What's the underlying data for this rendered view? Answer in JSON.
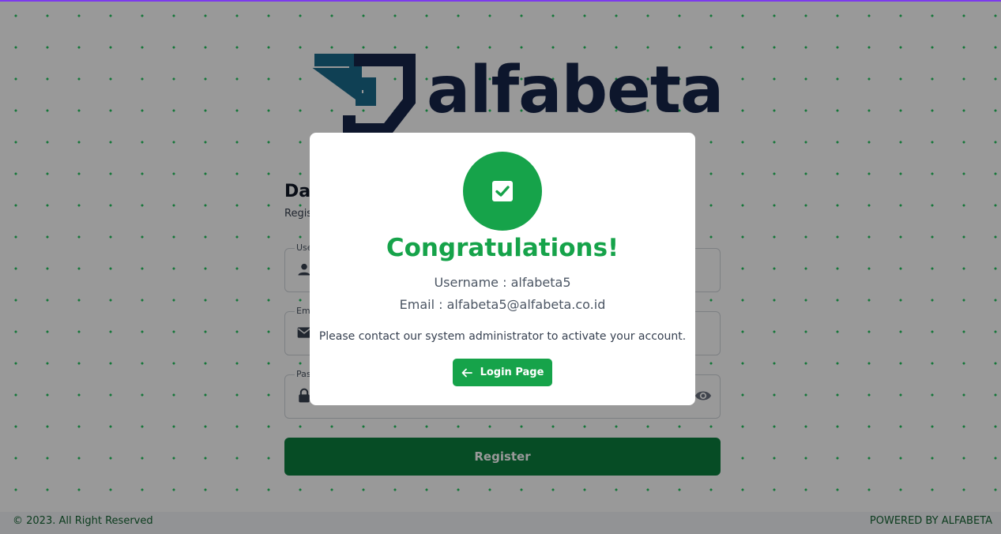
{
  "brand": {
    "name": "alfabeta",
    "accent": "#16a34a",
    "dark": "#16254a",
    "teal": "#1a6b8c"
  },
  "form": {
    "title": "Da",
    "subtitle": "Regis",
    "fields": [
      {
        "label": "Use",
        "icon": "user-icon"
      },
      {
        "label": "Em",
        "icon": "mail-icon"
      },
      {
        "label": "Pas",
        "icon": "lock-icon",
        "trailing_icon": "eye-icon"
      }
    ],
    "submit_label": "Register"
  },
  "modal": {
    "icon": "check-square-icon",
    "title": "Congratulations!",
    "username_line": "Username : alfabeta5",
    "email_line": "Email : alfabeta5@alfabeta.co.id",
    "note": "Please contact our system administrator to activate your account.",
    "button_label": "Login Page",
    "button_icon": "arrow-left-icon"
  },
  "footer": {
    "copyright": "© 2023. All Right Reserved",
    "powered_by": "POWERED BY ALFABETA"
  }
}
